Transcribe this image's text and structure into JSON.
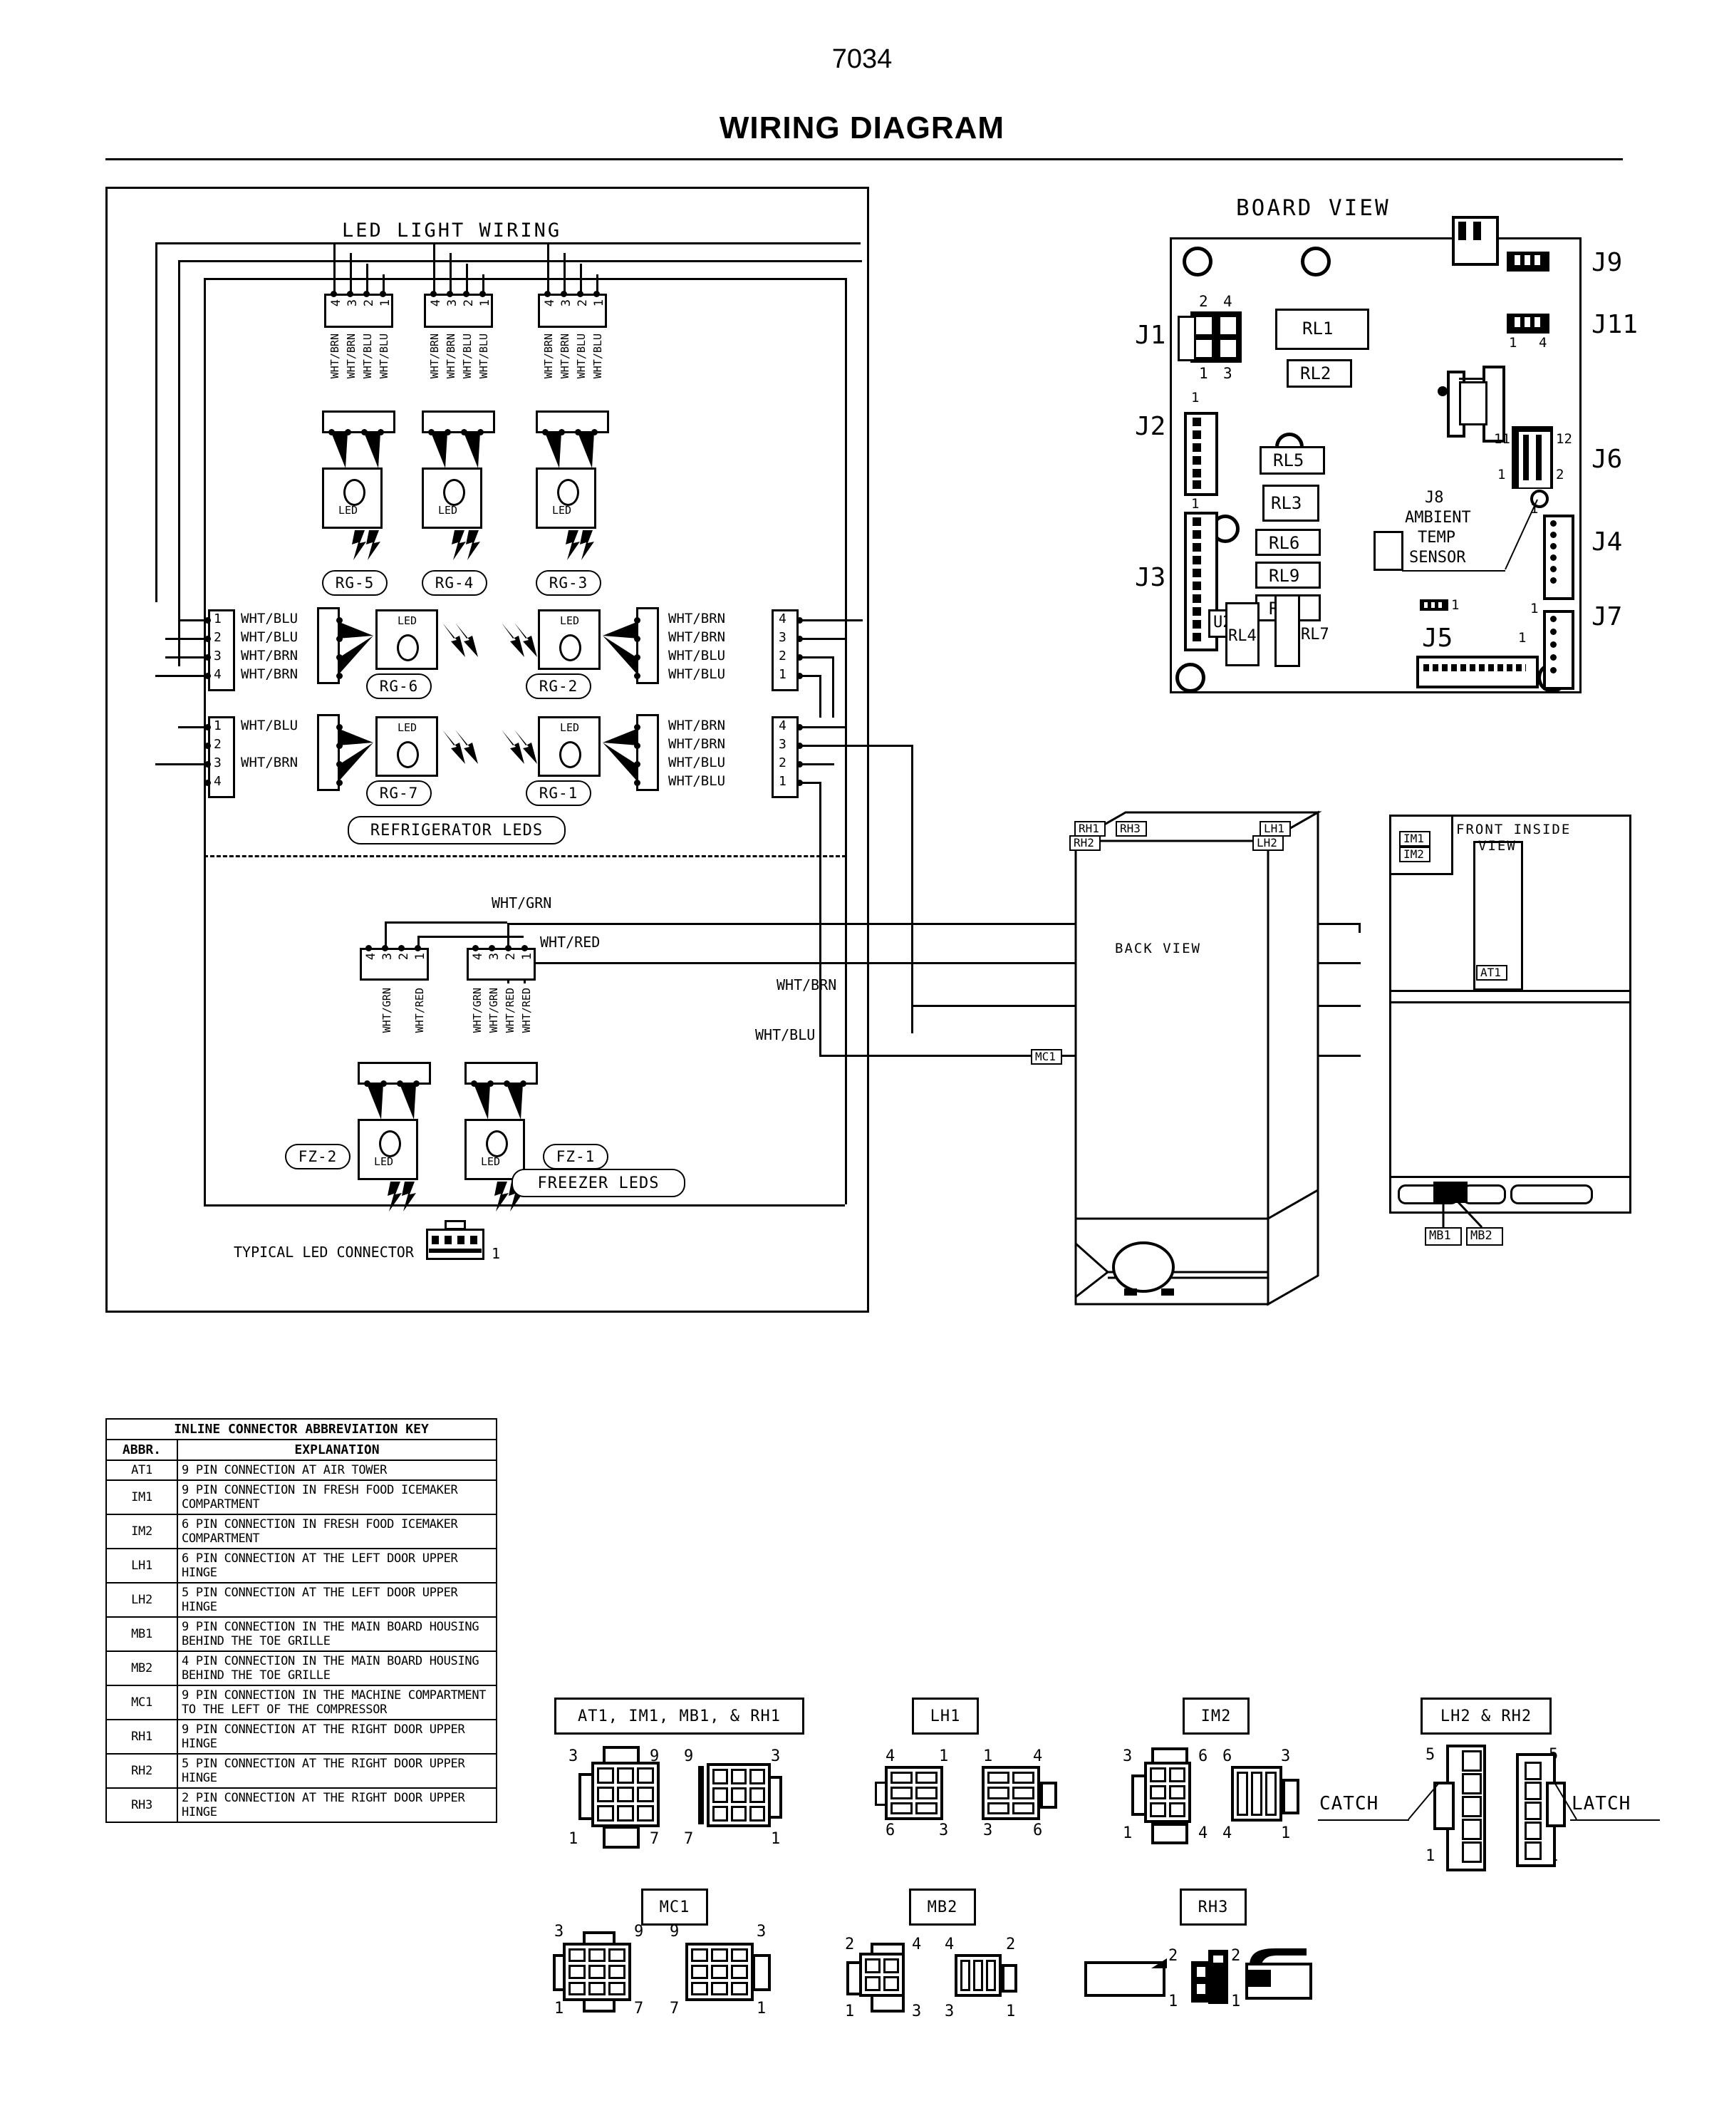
{
  "document": {
    "number": "7034",
    "title": "WIRING DIAGRAM"
  },
  "led_panel": {
    "title": "LED LIGHT WIRING",
    "refrigerator_group_label": "REFRIGERATOR LEDS",
    "freezer_group_label": "FREEZER LEDS",
    "typical_connector_label": "TYPICAL LED CONNECTOR",
    "typical_connector_pin": "1",
    "led_text": "LED",
    "top_row": [
      {
        "tag": "RG-5",
        "pins": [
          "4",
          "3",
          "2",
          "1"
        ],
        "wires": [
          "WHT/BRN",
          "WHT/BRN",
          "WHT/BLU",
          "WHT/BLU"
        ]
      },
      {
        "tag": "RG-4",
        "pins": [
          "4",
          "3",
          "2",
          "1"
        ],
        "wires": [
          "WHT/BRN",
          "WHT/BRN",
          "WHT/BLU",
          "WHT/BLU"
        ]
      },
      {
        "tag": "RG-3",
        "pins": [
          "4",
          "3",
          "2",
          "1"
        ],
        "wires": [
          "WHT/BRN",
          "WHT/BRN",
          "WHT/BLU",
          "WHT/BLU"
        ]
      }
    ],
    "left_column": [
      {
        "tag": "RG-6",
        "pins": [
          "1",
          "2",
          "3",
          "4"
        ],
        "wires": [
          "WHT/BLU",
          "WHT/BLU",
          "WHT/BRN",
          "WHT/BRN"
        ]
      },
      {
        "tag": "RG-7",
        "pins": [
          "1",
          "2",
          "3",
          "4"
        ],
        "wires": [
          "WHT/BLU",
          "",
          "WHT/BRN",
          ""
        ]
      }
    ],
    "right_column": [
      {
        "tag": "RG-2",
        "pins": [
          "4",
          "3",
          "2",
          "1"
        ],
        "wires": [
          "WHT/BRN",
          "WHT/BRN",
          "WHT/BLU",
          "WHT/BLU"
        ]
      },
      {
        "tag": "RG-1",
        "pins": [
          "4",
          "3",
          "2",
          "1"
        ],
        "wires": [
          "WHT/BRN",
          "WHT/BRN",
          "WHT/BLU",
          "WHT/BLU"
        ]
      }
    ],
    "freezer": [
      {
        "tag": "FZ-2",
        "pins": [
          "4",
          "3",
          "2",
          "1"
        ],
        "wires": [
          "",
          "WHT/GRN",
          "",
          "WHT/RED"
        ]
      },
      {
        "tag": "FZ-1",
        "pins": [
          "4",
          "3",
          "2",
          "1"
        ],
        "wires": [
          "WHT/GRN",
          "WHT/GRN",
          "WHT/RED",
          "WHT/RED"
        ]
      }
    ],
    "bus_labels": {
      "wht_grn": "WHT/GRN",
      "wht_red": "WHT/RED",
      "wht_brn": "WHT/BRN",
      "wht_blu": "WHT/BLU"
    }
  },
  "board_view": {
    "title": "BOARD VIEW",
    "sensor_note": [
      "J8",
      "AMBIENT",
      "TEMP",
      "SENSOR"
    ],
    "connectors": [
      {
        "id": "J1",
        "pins": [
          "2",
          "4",
          "1",
          "3"
        ]
      },
      {
        "id": "J2",
        "pins": [
          "1"
        ]
      },
      {
        "id": "J3",
        "pins": [
          "1"
        ]
      },
      {
        "id": "J4",
        "pins": [
          "1"
        ]
      },
      {
        "id": "J5",
        "pins": [
          "1"
        ]
      },
      {
        "id": "J6",
        "pins": [
          "11",
          "12",
          "1",
          "2"
        ]
      },
      {
        "id": "J7",
        "pins": [
          "1"
        ]
      },
      {
        "id": "J9",
        "pins": []
      },
      {
        "id": "J11",
        "pins": [
          "1",
          "4"
        ]
      }
    ],
    "relays": [
      "RL1",
      "RL2",
      "RL5",
      "RL3",
      "RL6",
      "RL9",
      "RL8",
      "RL4",
      "RL7"
    ],
    "ic": "U2",
    "jumper_pin": "1"
  },
  "back_view": {
    "title": "BACK VIEW",
    "callouts": [
      "RH1",
      "RH3",
      "RH2",
      "LH1",
      "LH2",
      "MC1"
    ]
  },
  "front_view": {
    "title_line1": "FRONT INSIDE",
    "title_line2": "VIEW",
    "callouts": [
      "IM1",
      "IM2",
      "AT1",
      "MB1",
      "MB2"
    ]
  },
  "key_table": {
    "title": "INLINE CONNECTOR ABBREVIATION KEY",
    "columns": [
      "ABBR.",
      "EXPLANATION"
    ],
    "rows": [
      {
        "abbr": "AT1",
        "explanation": "9 PIN CONNECTION AT AIR TOWER"
      },
      {
        "abbr": "IM1",
        "explanation": "9 PIN CONNECTION IN FRESH FOOD ICEMAKER COMPARTMENT"
      },
      {
        "abbr": "IM2",
        "explanation": "6 PIN CONNECTION IN FRESH FOOD ICEMAKER COMPARTMENT"
      },
      {
        "abbr": "LH1",
        "explanation": "6 PIN CONNECTION AT THE LEFT DOOR UPPER HINGE"
      },
      {
        "abbr": "LH2",
        "explanation": "5 PIN CONNECTION AT THE LEFT DOOR UPPER HINGE"
      },
      {
        "abbr": "MB1",
        "explanation": "9 PIN CONNECTION IN THE MAIN BOARD HOUSING BEHIND THE TOE GRILLE"
      },
      {
        "abbr": "MB2",
        "explanation": "4 PIN CONNECTION IN THE MAIN BOARD HOUSING BEHIND THE TOE GRILLE"
      },
      {
        "abbr": "MC1",
        "explanation": "9 PIN CONNECTION IN THE MACHINE COMPARTMENT TO THE LEFT OF THE COMPRESSOR"
      },
      {
        "abbr": "RH1",
        "explanation": "9 PIN CONNECTION AT THE RIGHT DOOR UPPER HINGE"
      },
      {
        "abbr": "RH2",
        "explanation": "5 PIN CONNECTION AT THE RIGHT DOOR UPPER HINGE"
      },
      {
        "abbr": "RH3",
        "explanation": "2 PIN CONNECTION AT THE RIGHT DOOR UPPER HINGE"
      }
    ]
  },
  "connector_figures": [
    {
      "caption": "AT1, IM1, MB1, & RH1",
      "left_view": {
        "tl": "3",
        "tr": "9",
        "bl": "1",
        "br": "7"
      },
      "right_view": {
        "tl": "9",
        "tr": "3",
        "bl": "7",
        "br": "1"
      }
    },
    {
      "caption": "LH1",
      "left_view": {
        "tl": "4",
        "tr": "1",
        "bl": "6",
        "br": "3"
      },
      "right_view": {
        "tl": "1",
        "tr": "4",
        "bl": "3",
        "br": "6"
      }
    },
    {
      "caption": "IM2",
      "left_view": {
        "tl": "3",
        "tr": "6",
        "bl": "1",
        "br": "4"
      },
      "right_view": {
        "tl": "6",
        "tr": "3",
        "bl": "4",
        "br": "1"
      }
    },
    {
      "caption": "LH2 & RH2",
      "left_view": {
        "top": "5",
        "bottom": "1",
        "note": "CATCH"
      },
      "right_view": {
        "top": "5",
        "bottom": "1",
        "note": "LATCH"
      }
    },
    {
      "caption": "MC1",
      "left_view": {
        "tl": "3",
        "tr": "9",
        "bl": "1",
        "br": "7"
      },
      "right_view": {
        "tl": "9",
        "tr": "3",
        "bl": "7",
        "br": "1"
      }
    },
    {
      "caption": "MB2",
      "left_view": {
        "tl": "2",
        "tr": "4",
        "bl": "1",
        "br": "3"
      },
      "right_view": {
        "tl": "4",
        "tr": "2",
        "bl": "3",
        "br": "1"
      }
    },
    {
      "caption": "RH3",
      "left_view": {
        "top": "2",
        "bottom": "1"
      },
      "right_view": {
        "top": "2",
        "bottom": "1"
      }
    }
  ]
}
